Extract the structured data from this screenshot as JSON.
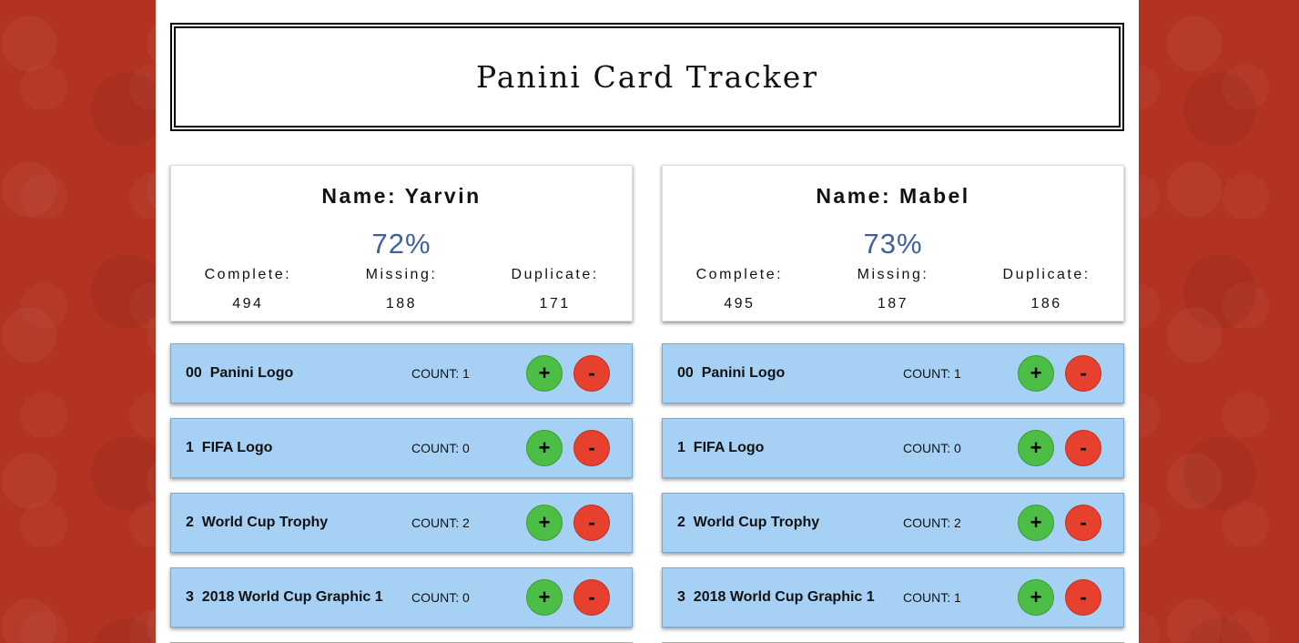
{
  "app": {
    "title": "Panini Card Tracker"
  },
  "collectors": [
    {
      "name_label": "Name: Yarvin",
      "percent": "72%",
      "labels": {
        "complete": "Complete:",
        "missing": "Missing:",
        "duplicate": "Duplicate:"
      },
      "complete": "494",
      "missing": "188",
      "duplicate": "171",
      "cards": [
        {
          "title": "00  Panini Logo",
          "count": "COUNT: 1"
        },
        {
          "title": "1  FIFA Logo",
          "count": "COUNT: 0"
        },
        {
          "title": "2  World Cup Trophy",
          "count": "COUNT: 2"
        },
        {
          "title": "3  2018 World Cup Graphic 1",
          "count": "COUNT: 0"
        }
      ]
    },
    {
      "name_label": "Name: Mabel",
      "percent": "73%",
      "labels": {
        "complete": "Complete:",
        "missing": "Missing:",
        "duplicate": "Duplicate:"
      },
      "complete": "495",
      "missing": "187",
      "duplicate": "186",
      "cards": [
        {
          "title": "00  Panini Logo",
          "count": "COUNT: 1"
        },
        {
          "title": "1  FIFA Logo",
          "count": "COUNT: 0"
        },
        {
          "title": "2  World Cup Trophy",
          "count": "COUNT: 2"
        },
        {
          "title": "3  2018 World Cup Graphic 1",
          "count": "COUNT: 1"
        }
      ]
    }
  ],
  "buttons": {
    "plus": "+",
    "minus": "-",
    "plus_icon": "plus-icon",
    "minus_icon": "minus-icon"
  },
  "colors": {
    "background": "#b23322",
    "card_row": "#a6d1f4",
    "plus_button": "#4cbd45",
    "minus_button": "#e8402f",
    "percent_text": "#3f5fa8"
  }
}
